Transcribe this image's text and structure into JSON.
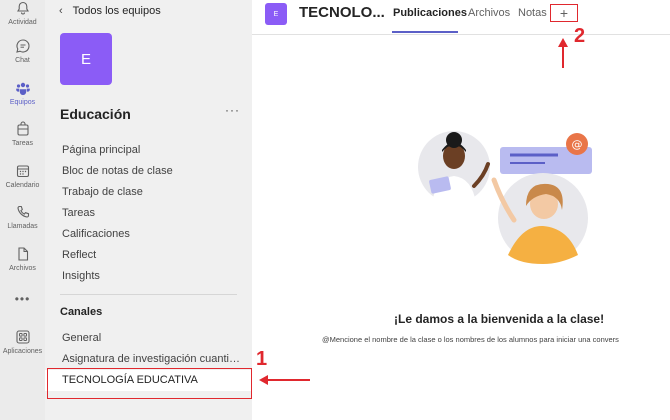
{
  "rail": {
    "items": [
      {
        "label": "Actividad",
        "icon": "bell-icon"
      },
      {
        "label": "Chat",
        "icon": "chat-icon"
      },
      {
        "label": "Equipos",
        "icon": "teams-icon"
      },
      {
        "label": "Tareas",
        "icon": "assignments-icon"
      },
      {
        "label": "Calendario",
        "icon": "calendar-icon"
      },
      {
        "label": "Llamadas",
        "icon": "phone-icon"
      },
      {
        "label": "Archivos",
        "icon": "file-icon"
      },
      {
        "label": "Aplicaciones",
        "icon": "apps-icon"
      }
    ],
    "more": "•••",
    "active": "Equipos"
  },
  "panel": {
    "back_label": "Todos los equipos",
    "team_initial": "E",
    "team_name": "Educación",
    "more": "···",
    "nav_items": [
      "Página principal",
      "Bloc de notas de clase",
      "Trabajo de clase",
      "Tareas",
      "Calificaciones",
      "Reflect",
      "Insights"
    ],
    "channels_title": "Canales",
    "channels": [
      "General",
      "Asignatura de investigación cuantitat...",
      "TECNOLOGÍA EDUCATIVA"
    ]
  },
  "header": {
    "avatar_initial": "E",
    "title": "TECNOLO...",
    "tabs": [
      "Publicaciones",
      "Archivos",
      "Notas"
    ],
    "add_tab": "+"
  },
  "annotations": {
    "one": "1",
    "two": "2",
    "color": "#e0282e"
  },
  "welcome": {
    "title": "¡Le damos a la bienvenida a la clase!",
    "subtitle": "@Mencione el nombre de la clase o los nombres de los alumnos para iniciar una convers"
  },
  "colors": {
    "accent": "#5b5fc7",
    "team_avatar": "#8b5cf6",
    "annotation": "#e0282e"
  }
}
